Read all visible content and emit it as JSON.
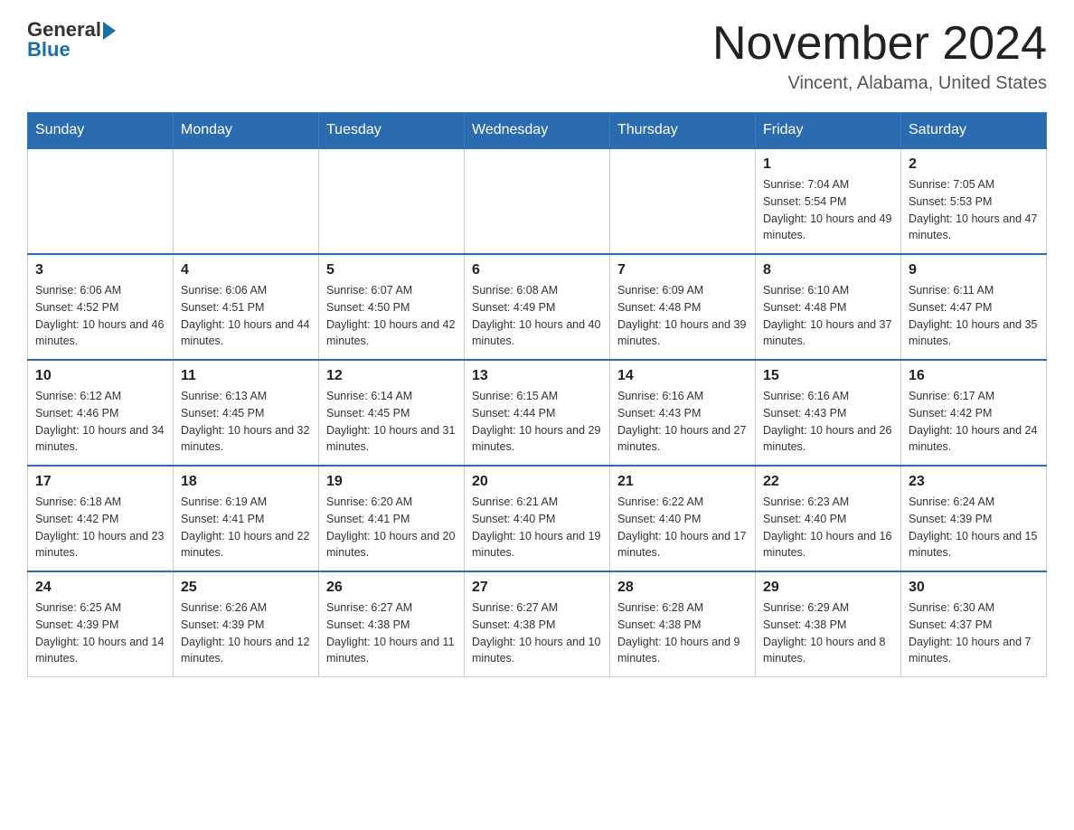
{
  "header": {
    "logo": {
      "text_general": "General",
      "text_blue": "Blue"
    },
    "title": "November 2024",
    "subtitle": "Vincent, Alabama, United States"
  },
  "calendar": {
    "days_of_week": [
      "Sunday",
      "Monday",
      "Tuesday",
      "Wednesday",
      "Thursday",
      "Friday",
      "Saturday"
    ],
    "weeks": [
      {
        "days": [
          {
            "number": "",
            "info": ""
          },
          {
            "number": "",
            "info": ""
          },
          {
            "number": "",
            "info": ""
          },
          {
            "number": "",
            "info": ""
          },
          {
            "number": "",
            "info": ""
          },
          {
            "number": "1",
            "info": "Sunrise: 7:04 AM\nSunset: 5:54 PM\nDaylight: 10 hours and 49 minutes."
          },
          {
            "number": "2",
            "info": "Sunrise: 7:05 AM\nSunset: 5:53 PM\nDaylight: 10 hours and 47 minutes."
          }
        ]
      },
      {
        "days": [
          {
            "number": "3",
            "info": "Sunrise: 6:06 AM\nSunset: 4:52 PM\nDaylight: 10 hours and 46 minutes."
          },
          {
            "number": "4",
            "info": "Sunrise: 6:06 AM\nSunset: 4:51 PM\nDaylight: 10 hours and 44 minutes."
          },
          {
            "number": "5",
            "info": "Sunrise: 6:07 AM\nSunset: 4:50 PM\nDaylight: 10 hours and 42 minutes."
          },
          {
            "number": "6",
            "info": "Sunrise: 6:08 AM\nSunset: 4:49 PM\nDaylight: 10 hours and 40 minutes."
          },
          {
            "number": "7",
            "info": "Sunrise: 6:09 AM\nSunset: 4:48 PM\nDaylight: 10 hours and 39 minutes."
          },
          {
            "number": "8",
            "info": "Sunrise: 6:10 AM\nSunset: 4:48 PM\nDaylight: 10 hours and 37 minutes."
          },
          {
            "number": "9",
            "info": "Sunrise: 6:11 AM\nSunset: 4:47 PM\nDaylight: 10 hours and 35 minutes."
          }
        ]
      },
      {
        "days": [
          {
            "number": "10",
            "info": "Sunrise: 6:12 AM\nSunset: 4:46 PM\nDaylight: 10 hours and 34 minutes."
          },
          {
            "number": "11",
            "info": "Sunrise: 6:13 AM\nSunset: 4:45 PM\nDaylight: 10 hours and 32 minutes."
          },
          {
            "number": "12",
            "info": "Sunrise: 6:14 AM\nSunset: 4:45 PM\nDaylight: 10 hours and 31 minutes."
          },
          {
            "number": "13",
            "info": "Sunrise: 6:15 AM\nSunset: 4:44 PM\nDaylight: 10 hours and 29 minutes."
          },
          {
            "number": "14",
            "info": "Sunrise: 6:16 AM\nSunset: 4:43 PM\nDaylight: 10 hours and 27 minutes."
          },
          {
            "number": "15",
            "info": "Sunrise: 6:16 AM\nSunset: 4:43 PM\nDaylight: 10 hours and 26 minutes."
          },
          {
            "number": "16",
            "info": "Sunrise: 6:17 AM\nSunset: 4:42 PM\nDaylight: 10 hours and 24 minutes."
          }
        ]
      },
      {
        "days": [
          {
            "number": "17",
            "info": "Sunrise: 6:18 AM\nSunset: 4:42 PM\nDaylight: 10 hours and 23 minutes."
          },
          {
            "number": "18",
            "info": "Sunrise: 6:19 AM\nSunset: 4:41 PM\nDaylight: 10 hours and 22 minutes."
          },
          {
            "number": "19",
            "info": "Sunrise: 6:20 AM\nSunset: 4:41 PM\nDaylight: 10 hours and 20 minutes."
          },
          {
            "number": "20",
            "info": "Sunrise: 6:21 AM\nSunset: 4:40 PM\nDaylight: 10 hours and 19 minutes."
          },
          {
            "number": "21",
            "info": "Sunrise: 6:22 AM\nSunset: 4:40 PM\nDaylight: 10 hours and 17 minutes."
          },
          {
            "number": "22",
            "info": "Sunrise: 6:23 AM\nSunset: 4:40 PM\nDaylight: 10 hours and 16 minutes."
          },
          {
            "number": "23",
            "info": "Sunrise: 6:24 AM\nSunset: 4:39 PM\nDaylight: 10 hours and 15 minutes."
          }
        ]
      },
      {
        "days": [
          {
            "number": "24",
            "info": "Sunrise: 6:25 AM\nSunset: 4:39 PM\nDaylight: 10 hours and 14 minutes."
          },
          {
            "number": "25",
            "info": "Sunrise: 6:26 AM\nSunset: 4:39 PM\nDaylight: 10 hours and 12 minutes."
          },
          {
            "number": "26",
            "info": "Sunrise: 6:27 AM\nSunset: 4:38 PM\nDaylight: 10 hours and 11 minutes."
          },
          {
            "number": "27",
            "info": "Sunrise: 6:27 AM\nSunset: 4:38 PM\nDaylight: 10 hours and 10 minutes."
          },
          {
            "number": "28",
            "info": "Sunrise: 6:28 AM\nSunset: 4:38 PM\nDaylight: 10 hours and 9 minutes."
          },
          {
            "number": "29",
            "info": "Sunrise: 6:29 AM\nSunset: 4:38 PM\nDaylight: 10 hours and 8 minutes."
          },
          {
            "number": "30",
            "info": "Sunrise: 6:30 AM\nSunset: 4:37 PM\nDaylight: 10 hours and 7 minutes."
          }
        ]
      }
    ]
  }
}
